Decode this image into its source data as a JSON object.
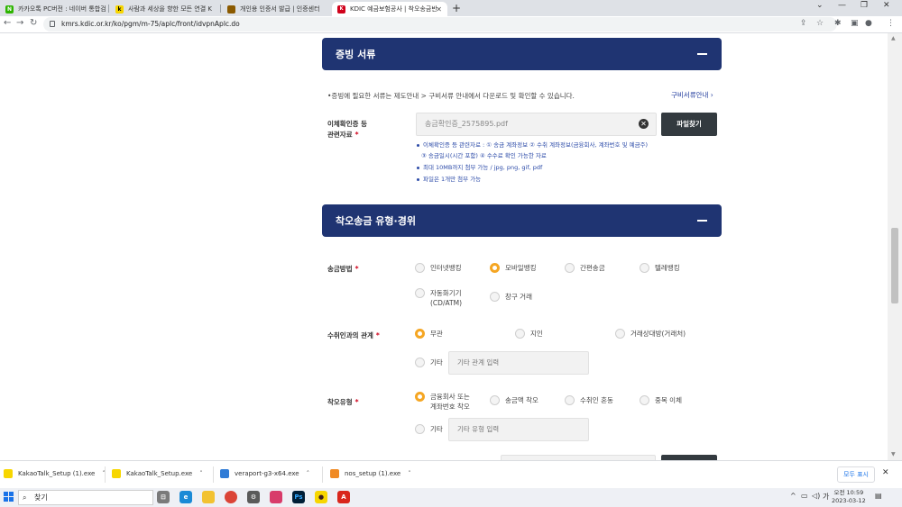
{
  "browser": {
    "tabs": [
      {
        "title": "카카오톡 PC버전 : 네이버 통합검",
        "fav_color": "#2db400",
        "fav_text": "N"
      },
      {
        "title": "사람과 세상을 향한 모든 연결 K",
        "fav_color": "#f7d600",
        "fav_text": "k"
      },
      {
        "title": "개인용 인증서 발급 | 인증센터",
        "fav_color": "#8b5a00",
        "fav_text": ""
      },
      {
        "title": "KDIC 예금보험공사 | 착오송금반",
        "fav_color": "#d0021b",
        "fav_text": "K"
      }
    ],
    "url": "kmrs.kdic.or.kr/ko/pgm/m-75/aplc/front/idvpnAplc.do"
  },
  "sections": {
    "docs": {
      "title": "증빙 서류"
    },
    "type": {
      "title": "착오송금 유형·경위"
    }
  },
  "docs": {
    "note": "•증빙에 필요한 서류는 제도안내 > 구비서류 안내에서 다운로드 및 확인할 수 있습니다.",
    "guide_link": "구비서류안내",
    "file_label_line1": "이체확인증 등",
    "file_label_line2": "관련자료",
    "file_value": "송금확인증_2575895.pdf",
    "file_button": "파일찾기",
    "bullets": [
      "이체확인증 등 관련자료 : ① 송금 계좌정보 ② 수취 계좌정보(금융회사, 계좌번호 및 예금주)",
      "③ 송금일시(시간 포함) ④ 수수료 확인 가능한 자료",
      "최대 10MB까지 첨부 가능 / jpg, png, gif, pdf",
      "파일은 1개만 첨부 가능"
    ]
  },
  "remit_method": {
    "label": "송금방법",
    "options": [
      {
        "label": "인터넷뱅킹",
        "selected": false
      },
      {
        "label": "모바일뱅킹",
        "selected": true
      },
      {
        "label": "간편송금",
        "selected": false
      },
      {
        "label": "텔레뱅킹",
        "selected": false
      },
      {
        "label_line1": "자동화기기",
        "label_line2": "(CD/ATM)",
        "selected": false
      },
      {
        "label": "창구 거래",
        "selected": false
      }
    ]
  },
  "relation": {
    "label": "수취인과의 관계",
    "options": [
      {
        "label": "무관",
        "selected": true
      },
      {
        "label": "지인",
        "selected": false
      },
      {
        "label": "거래상대방(거래처)",
        "selected": false
      },
      {
        "label": "기타",
        "selected": false
      }
    ],
    "other_placeholder": "기타 관계 입력"
  },
  "error_type": {
    "label": "착오유형",
    "options": [
      {
        "label_line1": "금융회사 또는",
        "label_line2": "계좌번호 착오",
        "selected": true
      },
      {
        "label": "송금액 착오",
        "selected": false
      },
      {
        "label": "수취인 혼동",
        "selected": false
      },
      {
        "label": "중복 이체",
        "selected": false
      },
      {
        "label": "기타",
        "selected": false
      }
    ],
    "other_placeholder": "기타 유형 입력"
  },
  "downloads": {
    "items": [
      {
        "name": "KakaoTalk_Setup (1).exe",
        "color": "#f7d600"
      },
      {
        "name": "KakaoTalk_Setup.exe",
        "color": "#f7d600"
      },
      {
        "name": "veraport-g3-x64.exe",
        "color": "#2f7bd6"
      },
      {
        "name": "nos_setup (1).exe",
        "color": "#f08a24"
      }
    ],
    "show_all": "모두 표시"
  },
  "taskbar": {
    "search_placeholder": "찾기",
    "ime": "가",
    "time": "오전 10:59",
    "date": "2023-03-12"
  }
}
